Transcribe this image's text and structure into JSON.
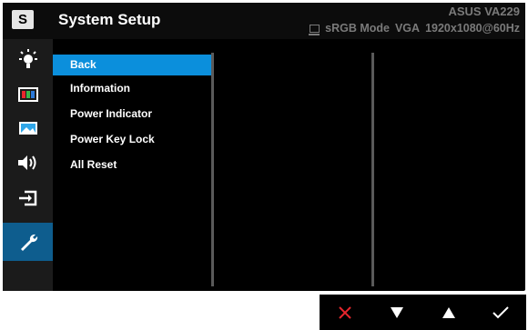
{
  "header": {
    "logo_letter": "S",
    "title": "System Setup",
    "brand": "ASUS  VA229",
    "status": {
      "mode": "sRGB Mode",
      "input": "VGA",
      "resolution": "1920x1080@60Hz"
    }
  },
  "sidebar": {
    "icons": [
      {
        "name": "brightness-icon"
      },
      {
        "name": "color-icon"
      },
      {
        "name": "image-icon"
      },
      {
        "name": "sound-icon"
      },
      {
        "name": "input-select-icon"
      },
      {
        "name": "system-setup-icon",
        "active": true
      }
    ]
  },
  "menu": {
    "items": [
      {
        "label": "Back",
        "selected": true
      },
      {
        "label": "Information"
      },
      {
        "label": "Power Indicator"
      },
      {
        "label": "Power Key Lock"
      },
      {
        "label": "All Reset"
      }
    ]
  },
  "nav": {
    "buttons": [
      {
        "name": "close-icon",
        "color": "#e8262d"
      },
      {
        "name": "down-arrow-icon",
        "color": "#ffffff"
      },
      {
        "name": "up-arrow-icon",
        "color": "#ffffff"
      },
      {
        "name": "confirm-check-icon",
        "color": "#ffffff"
      }
    ]
  },
  "colors": {
    "accent": "#0b8fdc",
    "active_icon_bg": "#0e5d8e",
    "close": "#e8262d"
  }
}
